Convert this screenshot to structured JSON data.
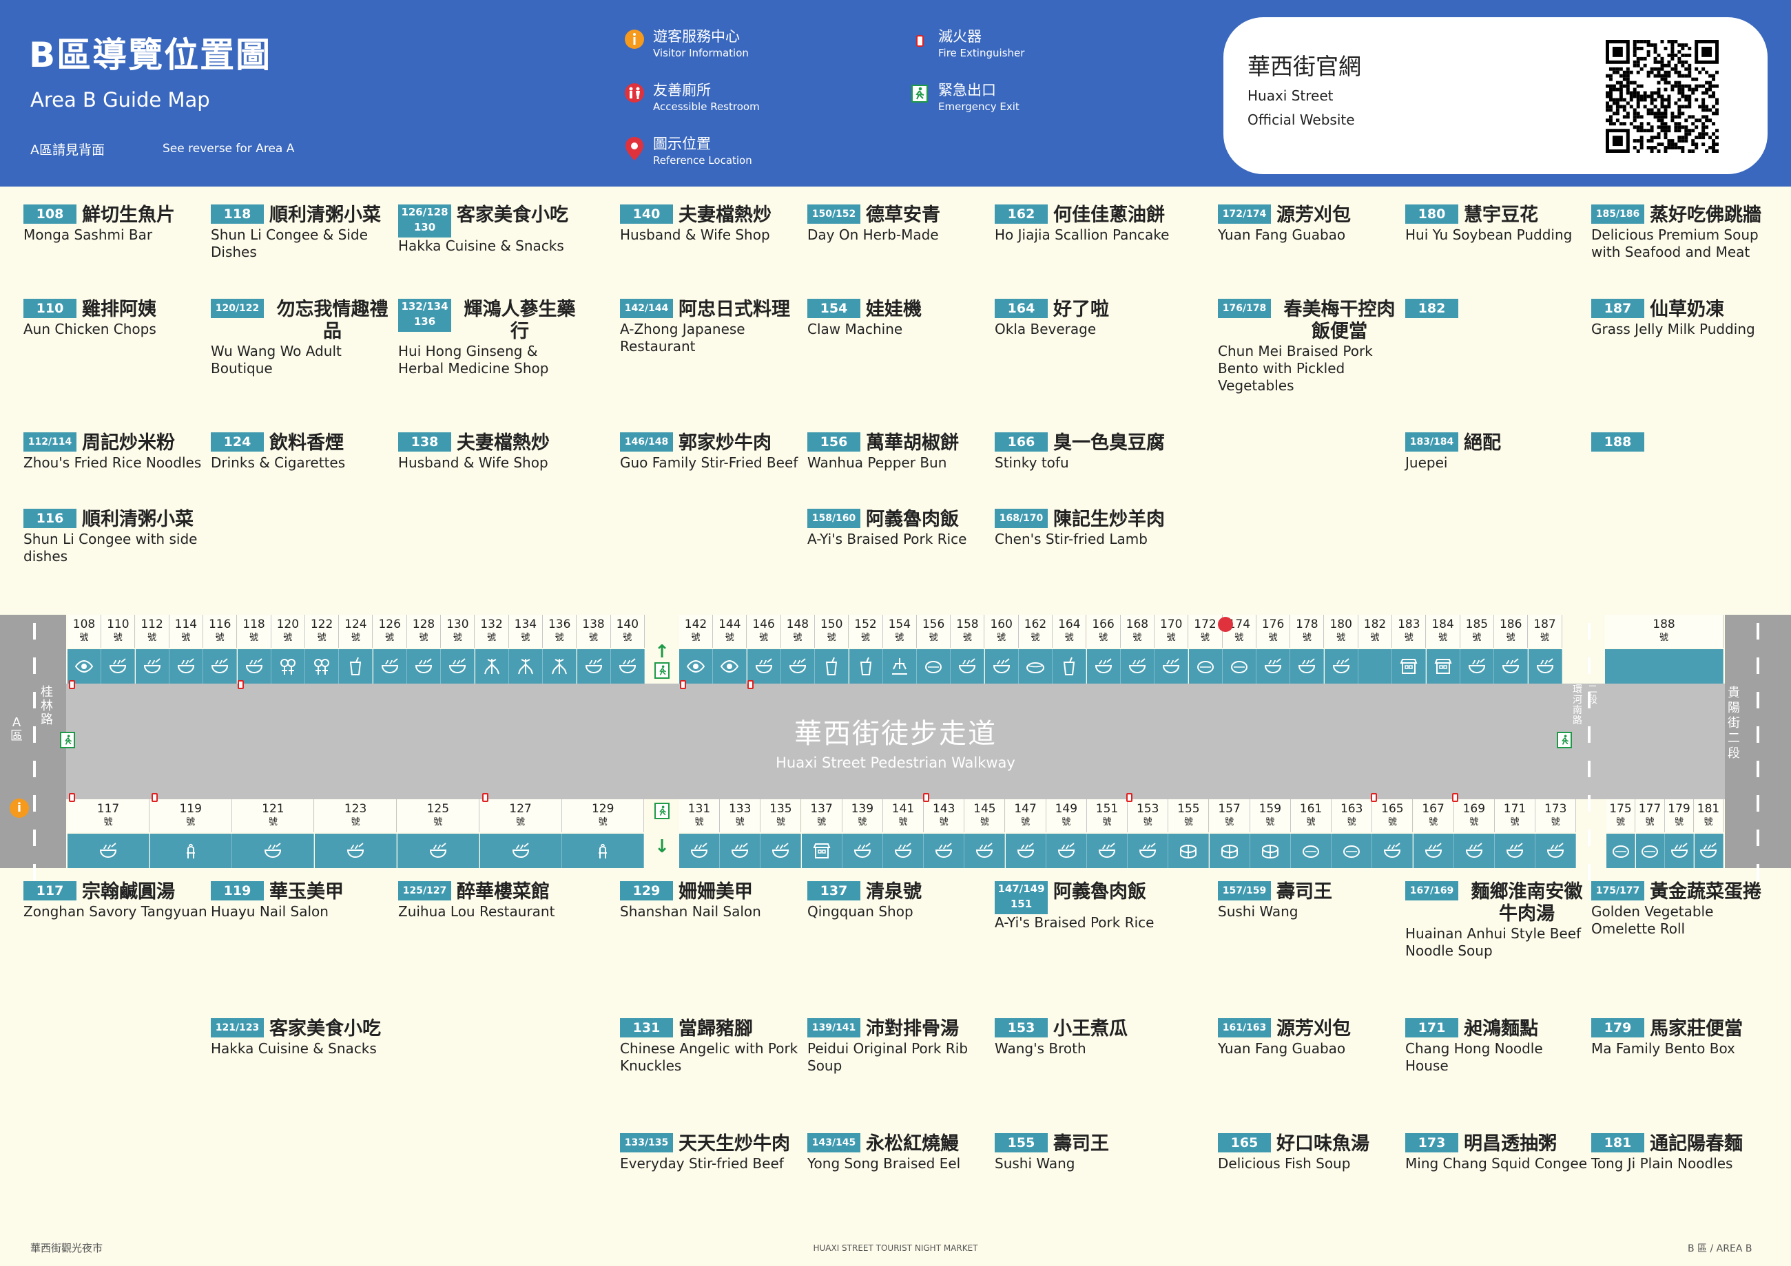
{
  "header": {
    "title": "B區導覽位置圖",
    "subtitle": "Area B Guide Map",
    "note_zh": "A區請見背面",
    "note_en": "See reverse for Area A"
  },
  "legend": [
    {
      "zh": "遊客服務中心",
      "en": "Visitor Information",
      "icon": "info-icon",
      "color": "#f59a1c"
    },
    {
      "zh": "友善廁所",
      "en": "Accessible Restroom",
      "icon": "restroom-icon",
      "color": "#e0323c"
    },
    {
      "zh": "圖示位置",
      "en": "Reference Location",
      "icon": "location-pin-icon",
      "color": "#e0323c"
    },
    {
      "zh": "滅火器",
      "en": "Fire Extinguisher",
      "icon": "fire-extinguisher-icon",
      "color": "#e02020"
    },
    {
      "zh": "緊急出口",
      "en": "Emergency Exit",
      "icon": "emergency-exit-icon",
      "color": "#1d9a48"
    }
  ],
  "website": {
    "zh": "華西街官網",
    "en1": "Huaxi Street",
    "en2": "Official Website",
    "icon": "qr-code-icon"
  },
  "shops_top": [
    {
      "num": "108",
      "zh": "鮮切生魚片",
      "en": "Monga Sashmi Bar"
    },
    {
      "num": "118",
      "zh": "順利清粥小菜",
      "en": "Shun Li Congee & Side Dishes"
    },
    {
      "num": "126/128 130",
      "zh": "客家美食小吃",
      "en": "Hakka Cuisine & Snacks"
    },
    {
      "num": "140",
      "zh": "夫妻檔熱炒",
      "en": "Husband & Wife Shop"
    },
    {
      "num": "150/152",
      "zh": "德草安青",
      "en": "Day On Herb-Made"
    },
    {
      "num": "162",
      "zh": "何佳佳蔥油餅",
      "en": "Ho Jiajia Scallion Pancake"
    },
    {
      "num": "172/174",
      "zh": "源芳刈包",
      "en": "Yuan Fang Guabao"
    },
    {
      "num": "180",
      "zh": "慧宇豆花",
      "en": "Hui Yu Soybean Pudding"
    },
    {
      "num": "185/186",
      "zh": "蒸好吃佛跳牆",
      "en": "Delicious Premium Soup with Seafood and Meat"
    },
    {
      "num": "110",
      "zh": "雞排阿姨",
      "en": "Aun Chicken Chops"
    },
    {
      "num": "120/122",
      "zh": "勿忘我情趣禮品",
      "en": "Wu Wang Wo Adult Boutique"
    },
    {
      "num": "132/134 136",
      "zh": "輝鴻人蔘生藥行",
      "en": "Hui Hong Ginseng & Herbal Medicine Shop"
    },
    {
      "num": "142/144",
      "zh": "阿忠日式料理",
      "en": "A-Zhong Japanese Restaurant"
    },
    {
      "num": "154",
      "zh": "娃娃機",
      "en": "Claw Machine"
    },
    {
      "num": "164",
      "zh": "好了啦",
      "en": "Okla Beverage"
    },
    {
      "num": "176/178",
      "zh": "春美梅干控肉飯便當",
      "en": "Chun Mei Braised Pork Bento with Pickled Vegetables"
    },
    {
      "num": "182",
      "zh": "",
      "en": ""
    },
    {
      "num": "187",
      "zh": "仙草奶凍",
      "en": "Grass Jelly Milk Pudding"
    },
    {
      "num": "112/114",
      "zh": "周記炒米粉",
      "en": "Zhou's Fried Rice Noodles"
    },
    {
      "num": "124",
      "zh": "飲料香煙",
      "en": "Drinks & Cigarettes"
    },
    {
      "num": "138",
      "zh": "夫妻檔熱炒",
      "en": "Husband & Wife Shop"
    },
    {
      "num": "146/148",
      "zh": "郭家炒牛肉",
      "en": "Guo Family Stir-Fried Beef"
    },
    {
      "num": "156",
      "zh": "萬華胡椒餅",
      "en": "Wanhua Pepper Bun"
    },
    {
      "num": "166",
      "zh": "臭一色臭豆腐",
      "en": "Stinky tofu"
    },
    {
      "num": "183/184",
      "zh": "絕配",
      "en": "Juepei"
    },
    {
      "num": "188",
      "zh": "",
      "en": ""
    },
    {
      "num": "116",
      "zh": "順利清粥小菜",
      "en": "Shun Li Congee with side dishes"
    },
    {
      "num": "158/160",
      "zh": "阿義魯肉飯",
      "en": "A-Yi's Braised Pork Rice"
    },
    {
      "num": "168/170",
      "zh": "陳記生炒羊肉",
      "en": "Chen's Stir-fried Lamb"
    }
  ],
  "shops_bottom": [
    {
      "num": "117",
      "zh": "宗翰鹹圓湯",
      "en": "Zonghan Savory Tangyuan"
    },
    {
      "num": "119",
      "zh": "華玉美甲",
      "en": "Huayu Nail Salon"
    },
    {
      "num": "125/127",
      "zh": "醉華樓菜館",
      "en": "Zuihua Lou Restaurant"
    },
    {
      "num": "129",
      "zh": "姍姍美甲",
      "en": "Shanshan Nail Salon"
    },
    {
      "num": "137",
      "zh": "清泉號",
      "en": "Qingquan Shop"
    },
    {
      "num": "147/149 151",
      "zh": "阿義魯肉飯",
      "en": "A-Yi's Braised Pork Rice"
    },
    {
      "num": "157/159",
      "zh": "壽司王",
      "en": "Sushi Wang"
    },
    {
      "num": "167/169",
      "zh": "麵鄉淮南安徽牛肉湯",
      "en": "Huainan Anhui Style Beef Noodle Soup"
    },
    {
      "num": "175/177",
      "zh": "黃金蔬菜蛋捲",
      "en": "Golden Vegetable Omelette Roll"
    },
    {
      "num": "121/123",
      "zh": "客家美食小吃",
      "en": "Hakka Cuisine & Snacks"
    },
    {
      "num": "131",
      "zh": "當歸豬腳",
      "en": "Chinese Angelic with Pork Knuckles"
    },
    {
      "num": "139/141",
      "zh": "沛對排骨湯",
      "en": "Peidui Original Pork Rib Soup"
    },
    {
      "num": "153",
      "zh": "小王煮瓜",
      "en": "Wang's Broth"
    },
    {
      "num": "161/163",
      "zh": "源芳刈包",
      "en": "Yuan Fang Guabao"
    },
    {
      "num": "171",
      "zh": "昶鴻麵點",
      "en": "Chang Hong Noodle House"
    },
    {
      "num": "179",
      "zh": "馬家莊便當",
      "en": "Ma Family Bento Box"
    },
    {
      "num": "133/135",
      "zh": "天天生炒牛肉",
      "en": "Everyday Stir-fried Beef"
    },
    {
      "num": "143/145",
      "zh": "永松紅燒鰻",
      "en": "Yong Song Braised Eel"
    },
    {
      "num": "155",
      "zh": "壽司王",
      "en": "Sushi Wang"
    },
    {
      "num": "165",
      "zh": "好口味魚湯",
      "en": "Delicious Fish Soup"
    },
    {
      "num": "173",
      "zh": "明昌透抽粥",
      "en": "Ming Chang Squid Congee"
    },
    {
      "num": "181",
      "zh": "通記陽春麵",
      "en": "Tong Ji Plain Noodles"
    }
  ],
  "map": {
    "walkway_zh": "華西街徒步走道",
    "walkway_en": "Huaxi Street Pedestrian Walkway",
    "left_road": "桂林路",
    "area_a": "A區",
    "right_road": "貴陽街二段",
    "left_end_road": "環河南路",
    "right_mid_road": "二段",
    "unit": "號",
    "top_numbers": [
      "108",
      "110",
      "112",
      "114",
      "116",
      "118",
      "120",
      "122",
      "124",
      "126",
      "128",
      "130",
      "132",
      "134",
      "136",
      "138",
      "140",
      "142",
      "144",
      "146",
      "148",
      "150",
      "152",
      "154",
      "156",
      "158",
      "160",
      "162",
      "164",
      "166",
      "168",
      "170",
      "172",
      "174",
      "176",
      "178",
      "180",
      "182",
      "183",
      "184",
      "185",
      "186",
      "187",
      "188"
    ],
    "bottom_numbers": [
      "117",
      "119",
      "121",
      "123",
      "125",
      "127",
      "129",
      "131",
      "133",
      "135",
      "137",
      "139",
      "141",
      "143",
      "145",
      "147",
      "149",
      "151",
      "153",
      "155",
      "157",
      "159",
      "161",
      "163",
      "165",
      "167",
      "169",
      "171",
      "173",
      "175",
      "177",
      "179",
      "181"
    ],
    "top_icons": [
      "eye",
      "bowl",
      "bowl",
      "bowl",
      "bowl",
      "bowl",
      "gift",
      "gift",
      "cup",
      "bowl",
      "bowl",
      "bowl",
      "herb",
      "herb",
      "herb",
      "bowl",
      "bowl",
      "eye",
      "eye",
      "bowl",
      "bowl",
      "cup",
      "cup",
      "claw",
      "bun",
      "bowl",
      "bowl",
      "pancake",
      "cup",
      "bowl",
      "bowl",
      "bowl",
      "bun",
      "bun",
      "bowl",
      "bowl",
      "bowl",
      "",
      "shop",
      "shop",
      "bowl",
      "bowl",
      "bowl",
      ""
    ],
    "bottom_icons": [
      "bowl",
      "nail",
      "bowl",
      "bowl",
      "bowl",
      "bowl",
      "nail",
      "bowl",
      "bowl",
      "bowl",
      "shop",
      "bowl",
      "bowl",
      "bowl",
      "bowl",
      "bowl",
      "bowl",
      "bowl",
      "bowl",
      "sushi",
      "sushi",
      "sushi",
      "bun",
      "bun",
      "bowl",
      "bowl",
      "bowl",
      "bowl",
      "bowl",
      "bun",
      "bun",
      "bowl",
      "bowl"
    ]
  },
  "footer": {
    "left": "華西街觀光夜市",
    "center": "HUAXI STREET TOURIST NIGHT MARKET",
    "right": "B 區 / AREA B"
  }
}
